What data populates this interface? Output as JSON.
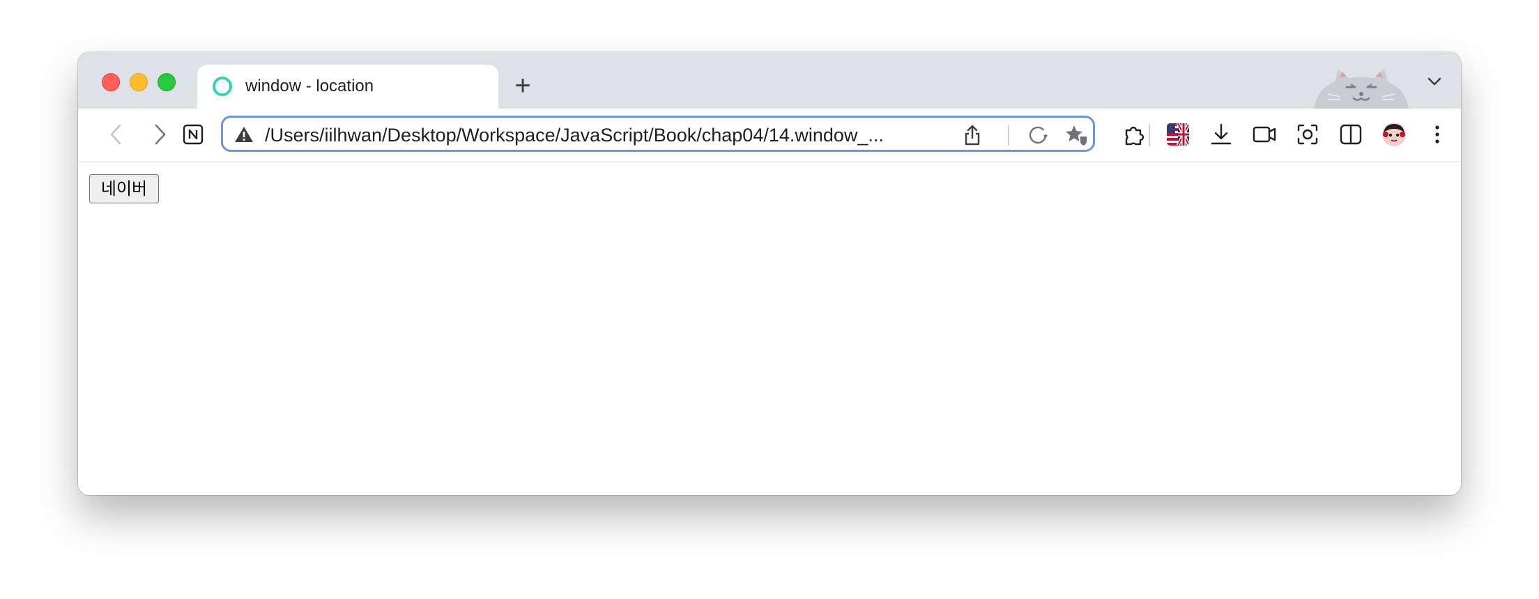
{
  "browser": {
    "tab": {
      "title": "window - location",
      "favicon": "circle-ring-icon",
      "favicon_color": "#34d3b3"
    },
    "new_tab_label": "+",
    "address_bar": {
      "url": "/Users/iilhwan/Desktop/Workspace/JavaScript/Book/chap04/14.window_...",
      "security_icon": "warning-triangle-icon",
      "focus_color": "#6b94e0"
    },
    "toolbar_icons": [
      "back-icon",
      "forward-icon",
      "notion-icon",
      "share-icon",
      "reload-icon",
      "bookmark-star-icon",
      "extensions-puzzle-icon",
      "translate-flag-icon",
      "download-icon",
      "video-capture-icon",
      "screenshot-icon",
      "split-view-icon",
      "profile-avatar-icon",
      "more-menu-icon"
    ],
    "traffic_lights": {
      "close": "#ff5f57",
      "minimize": "#febc2e",
      "zoom": "#28c840"
    }
  },
  "page": {
    "button_label": "네이버"
  }
}
